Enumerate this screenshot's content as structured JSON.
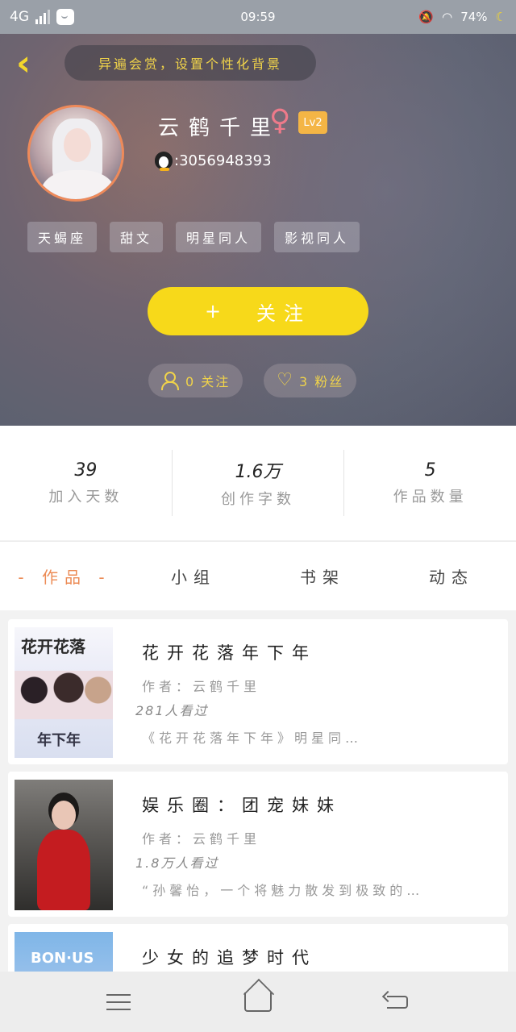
{
  "status_bar": {
    "network": "4G",
    "time": "09:59",
    "battery": "74%"
  },
  "header": {
    "bg_pill": "异遍会赏，设置个性化背景",
    "username": "云鹤千里",
    "gender_symbol": "♀",
    "level": "Lv2",
    "qq": ":3056948393",
    "tags": [
      "天蝎座",
      "甜文",
      "明星同人",
      "影视同人"
    ],
    "follow_label": "关注",
    "follow_plus": "+",
    "following_count": "0 关注",
    "fans_count": "3 粉丝"
  },
  "stats": [
    {
      "value": "39",
      "label": "加入天数"
    },
    {
      "value": "1.6万",
      "label": "创作字数"
    },
    {
      "value": "5",
      "label": "作品数量"
    }
  ],
  "tabs": [
    "- 作品 -",
    "小组",
    "书架",
    "动态"
  ],
  "works": [
    {
      "cover_title": "花开花落",
      "cover_sub": "年下年",
      "title": "花开花落年下年",
      "author": "作者：云鹤千里",
      "views": "281人看过",
      "desc": "《花开花落年下年》明星同…"
    },
    {
      "title": "娱乐圈：团宠妹妹",
      "author": "作者：云鹤千里",
      "views": "1.8万人看过",
      "desc": "“孙馨怡，一个将魅力散发到极致的…"
    },
    {
      "cover_text": "BON·US",
      "title": "少女的追梦时代"
    }
  ],
  "colors": {
    "accent_yellow": "#f7d91a",
    "accent_orange": "#ec8b55"
  }
}
